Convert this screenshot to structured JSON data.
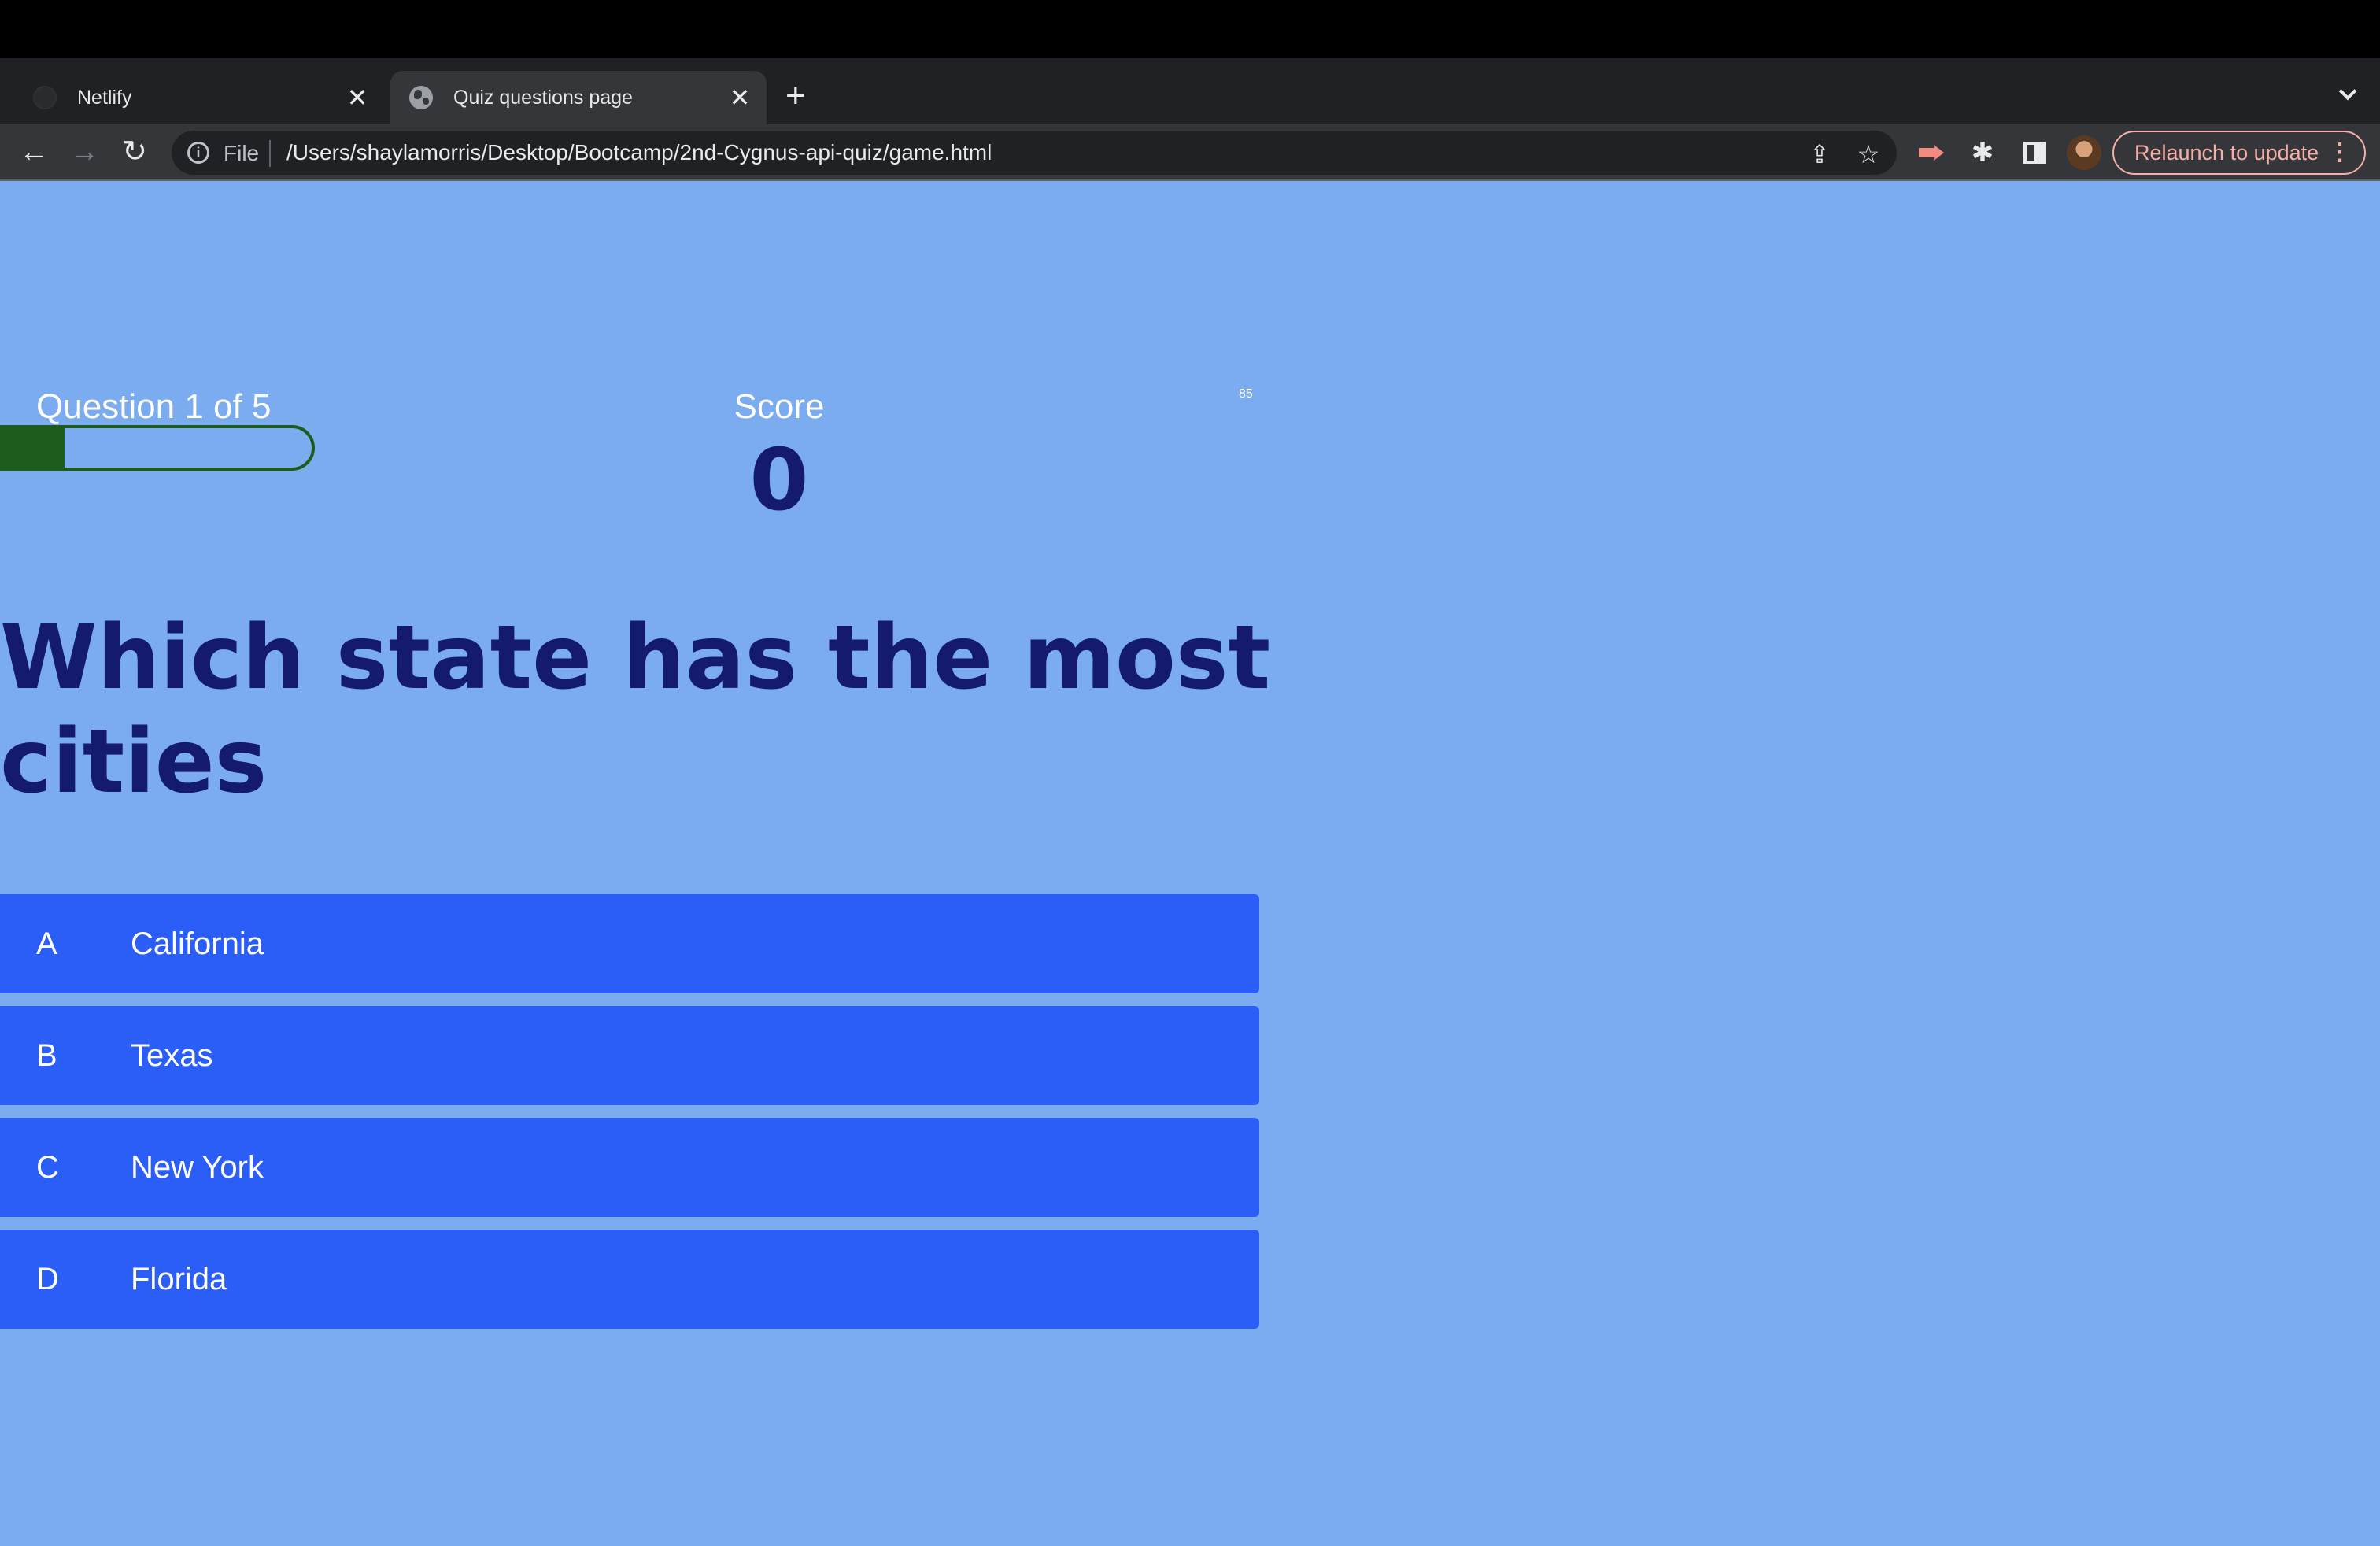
{
  "browser": {
    "tabs": [
      {
        "title": "Netlify",
        "active": false
      },
      {
        "title": "Quiz questions page",
        "active": true
      }
    ],
    "address": {
      "scheme_label": "File",
      "url": "/Users/shaylamorris/Desktop/Bootcamp/2nd-Cygnus-api-quiz/game.html"
    },
    "relaunch_label": "Relaunch to update"
  },
  "quiz": {
    "question_counter": "Question 1 of 5",
    "progress_fraction": 0.2,
    "score_label": "Score",
    "score_value": "0",
    "small_number": "85",
    "question": "Which state has the most cities",
    "choices": [
      {
        "prefix": "A",
        "text": "California"
      },
      {
        "prefix": "B",
        "text": "Texas"
      },
      {
        "prefix": "C",
        "text": "New York"
      },
      {
        "prefix": "D",
        "text": "Florida"
      }
    ]
  },
  "colors": {
    "page_background": "#7aacef",
    "choice_background": "#2b5ef6",
    "heading_color": "#141a6e",
    "progress_fill": "#1e5b1e"
  }
}
